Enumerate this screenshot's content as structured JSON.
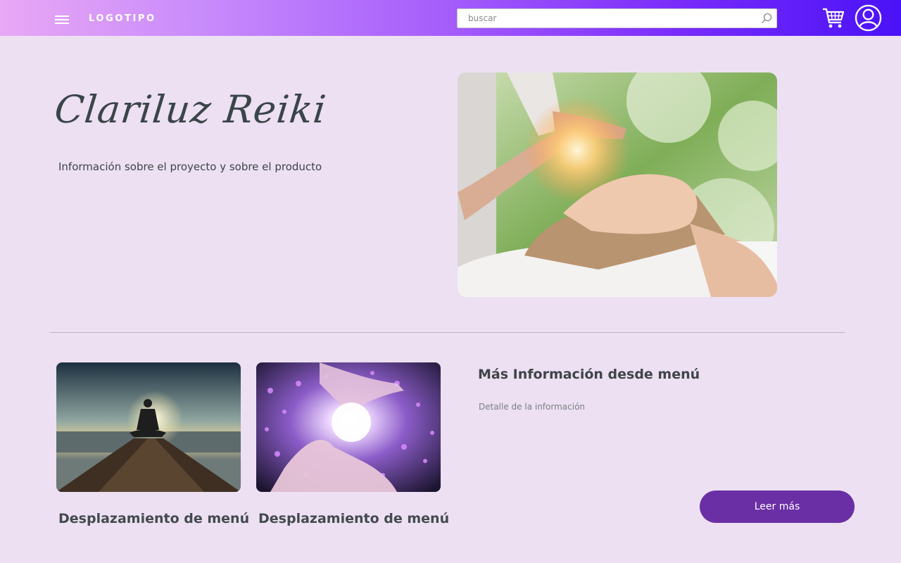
{
  "header": {
    "logo": "LOGOTIPO",
    "search_placeholder": "buscar",
    "icons": [
      "menu-icon",
      "search-icon",
      "cart-icon",
      "user-account-icon"
    ],
    "gradient_colors": [
      "#e9a8f5",
      "#a45cfb",
      "#4a12f7"
    ]
  },
  "hero": {
    "title": "Clariluz Reiki",
    "text": "Información sobre el proyecto y sobre el producto",
    "image": "reiki-healing-hands-over-woman-photo"
  },
  "cards": [
    {
      "image": "meditation-on-pier-at-sunset-photo",
      "title": "Desplazamiento de menú"
    },
    {
      "image": "glowing-energy-between-hands-photo",
      "title": "Desplazamiento de menú"
    }
  ],
  "info": {
    "title": "Más Información desde menú",
    "detail": "Detalle de la información",
    "button_label": "Leer más"
  },
  "colors": {
    "background": "#ede0f3",
    "button": "#6a2fa5",
    "text": "#3f4448"
  }
}
